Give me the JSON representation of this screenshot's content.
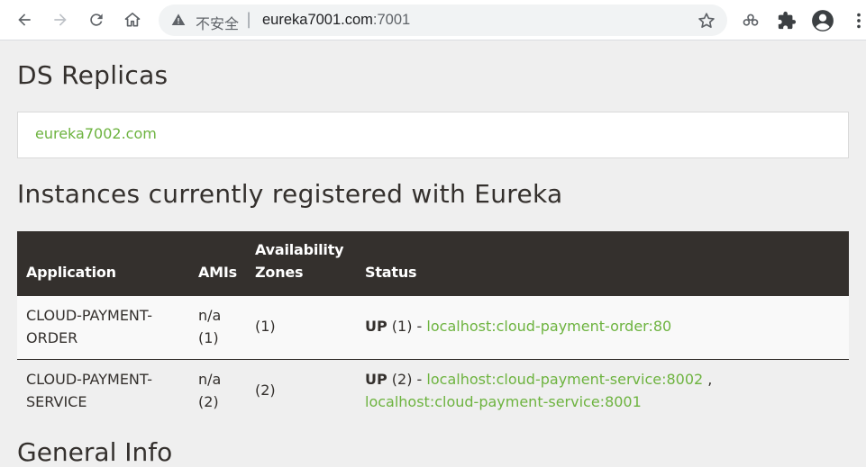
{
  "browser": {
    "omnibox": {
      "insecure_label": "不安全",
      "url_host": "eureka7001.com",
      "url_port": ":7001"
    }
  },
  "page": {
    "replicas_heading": "DS Replicas",
    "replicas": [
      "eureka7002.com"
    ],
    "instances_heading": "Instances currently registered with Eureka",
    "table": {
      "headers": {
        "application": "Application",
        "amis": "AMIs",
        "zones_line1": "Availability",
        "zones_line2": "Zones",
        "status": "Status"
      },
      "rows": [
        {
          "app_line1": "CLOUD-PAYMENT-",
          "app_line2": "ORDER",
          "ami_line1": "n/a",
          "ami_line2": "(1)",
          "zone": "(1)",
          "status_state": "UP",
          "status_count": " (1) - ",
          "links": [
            "localhost:cloud-payment-order:80"
          ]
        },
        {
          "app_line1": "CLOUD-PAYMENT-",
          "app_line2": "SERVICE",
          "ami_line1": "n/a",
          "ami_line2": "(2)",
          "zone": "(2)",
          "status_state": "UP",
          "status_count": " (2) - ",
          "links": [
            "localhost:cloud-payment-service:8002",
            "localhost:cloud-payment-service:8001"
          ],
          "link_separator": " ,"
        }
      ]
    },
    "next_heading_partial": "General Info"
  },
  "colors": {
    "header_bg": "#34302d",
    "link": "#6db33f",
    "page_bg": "#efefef"
  }
}
